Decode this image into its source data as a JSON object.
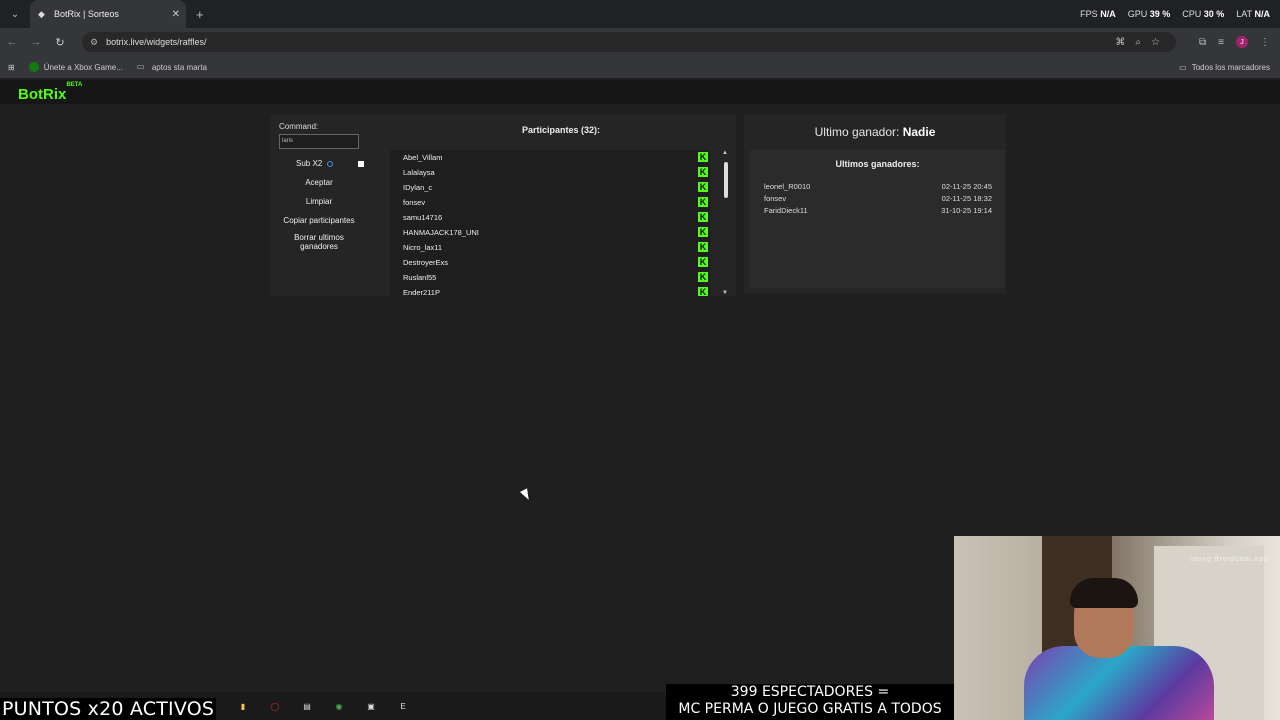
{
  "browser": {
    "tab_title": "BotRix | Sorteos",
    "url": "botrix.live/widgets/raffles/",
    "bookmarks": [
      "Únete a Xbox Game...",
      "aptos sta marta"
    ],
    "all_bookmarks": "Todos los marcadores",
    "profile_initial": "J"
  },
  "stats": {
    "fps_label": "FPS",
    "fps_value": "N/A",
    "gpu_label": "GPU",
    "gpu_value": "39 %",
    "cpu_label": "CPU",
    "cpu_value": "30 %",
    "lat_label": "LAT",
    "lat_value": "N/A"
  },
  "app": {
    "logo": "BotRix",
    "beta": "BETA"
  },
  "controls": {
    "command_label": "Command:",
    "command_value": "laris",
    "sub_label": "Sub X2",
    "accept": "Aceptar",
    "clear": "Limpiar",
    "copy": "Copiar participantes",
    "delete_winners": "Borrar ultimos ganadores"
  },
  "participants": {
    "title": "Participantes (32):",
    "items": [
      "Abel_Villam",
      "Lalalaysa",
      "IDylan_c",
      "fonsev",
      "samu14716",
      "HANMAJACK178_UNI",
      "Nicro_lax11",
      "DestroyerExs",
      "Ruslanl55",
      "Ender211P"
    ],
    "platform_icon": "K"
  },
  "winners": {
    "last_label": "Ultimo ganador:",
    "last_value": "Nadie",
    "title": "Ultimos ganadores:",
    "items": [
      {
        "name": "leonel_R0010",
        "date": "02-11-25 20:45"
      },
      {
        "name": "fonsev",
        "date": "02-11-25 18:32"
      },
      {
        "name": "FaridDieck11",
        "date": "31-10-25 19:14"
      }
    ]
  },
  "overlay": {
    "points": "PUNTOS x20 ACTIVOS",
    "viewers_line1": "399 ESPECTADORES =",
    "viewers_line2": "MC PERMA O JUEGO GRATIS A TODOS",
    "cam_label": "using droidcam.app"
  },
  "colors": {
    "accent": "#53fc18",
    "background": "#1f1f1f",
    "panel": "#252525"
  }
}
